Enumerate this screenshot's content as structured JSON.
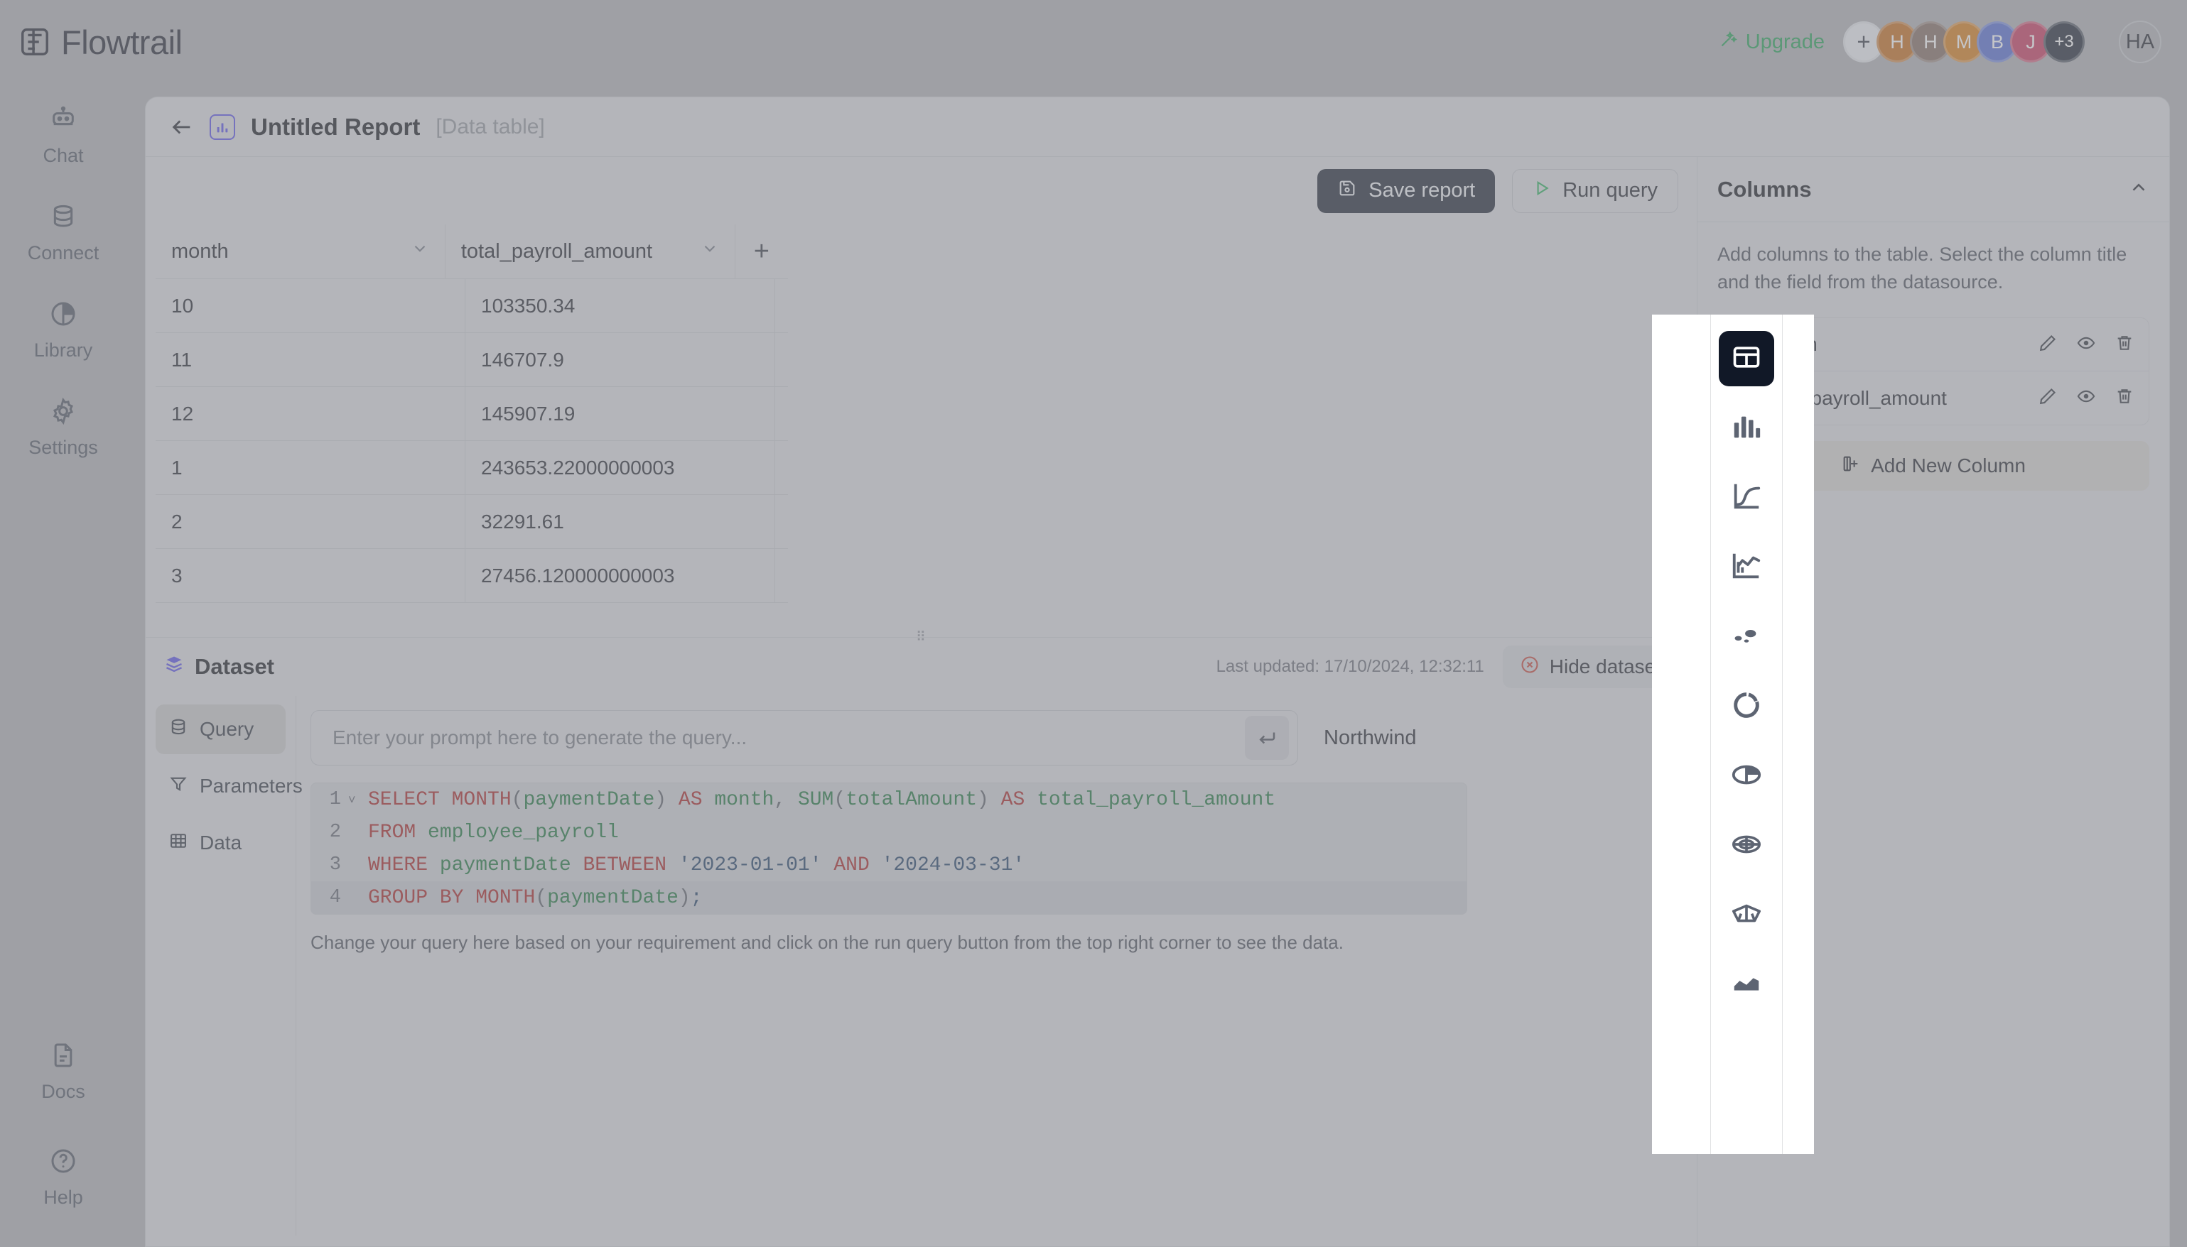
{
  "app": {
    "brand": "Flowtrail",
    "brand_logo_icon": "flowtrail-logo-icon"
  },
  "topbar": {
    "upgrade_label": "Upgrade",
    "upgrade_icon": "magic-wand-icon",
    "upgrade_color": "#179a4a",
    "add_member_label": "+",
    "avatars": [
      {
        "initial": "H",
        "color": "#c2620c"
      },
      {
        "initial": "H",
        "color": "#7b6258"
      },
      {
        "initial": "M",
        "color": "#d2730a"
      },
      {
        "initial": "B",
        "color": "#4a63cf"
      },
      {
        "initial": "J",
        "color": "#c32b52"
      }
    ],
    "overflow_label": "+3",
    "current_user_initials": "HA"
  },
  "rail": {
    "top_items": [
      {
        "label": "Chat",
        "icon": "robot-icon"
      },
      {
        "label": "Connect",
        "icon": "database-icon"
      },
      {
        "label": "Library",
        "icon": "pie-chart-icon"
      },
      {
        "label": "Settings",
        "icon": "gear-icon"
      }
    ],
    "bottom_items": [
      {
        "label": "Docs",
        "icon": "document-icon"
      },
      {
        "label": "Help",
        "icon": "question-circle-icon"
      }
    ]
  },
  "report": {
    "back_icon": "arrow-left-icon",
    "type_icon": "bar-chart-icon",
    "title": "Untitled Report",
    "subtitle": "[Data table]",
    "save_label": "Save report",
    "save_icon": "save-icon",
    "run_label": "Run query",
    "run_icon": "play-icon"
  },
  "table": {
    "columns": [
      {
        "label": "month",
        "caret_icon": "chevron-down-icon"
      },
      {
        "label": "total_payroll_amount",
        "caret_icon": "chevron-down-icon"
      }
    ],
    "add_column_label": "+",
    "rows": [
      {
        "month": "10",
        "total_payroll_amount": "103350.34"
      },
      {
        "month": "11",
        "total_payroll_amount": "146707.9"
      },
      {
        "month": "12",
        "total_payroll_amount": "145907.19"
      },
      {
        "month": "1",
        "total_payroll_amount": "243653.22000000003"
      },
      {
        "month": "2",
        "total_payroll_amount": "32291.61"
      },
      {
        "month": "3",
        "total_payroll_amount": "27456.120000000003"
      }
    ]
  },
  "dataset": {
    "title": "Dataset",
    "title_icon": "stack-icon",
    "last_updated": "Last updated: 17/10/2024, 12:32:11",
    "hide_label": "Hide dataset",
    "hide_icon": "close-circle-icon",
    "tabs": [
      {
        "label": "Query",
        "icon": "database-icon",
        "active": true
      },
      {
        "label": "Parameters",
        "icon": "filter-icon",
        "active": false
      },
      {
        "label": "Data",
        "icon": "grid-icon",
        "active": false
      }
    ],
    "prompt_placeholder": "Enter your prompt here to generate the query...",
    "prompt_value": "",
    "enter_icon": "enter-key-icon",
    "datasource_label": "Northwind",
    "datasource_icon": "datasource-icon",
    "datasource_caret": "chevron-down-icon",
    "hint": "Change your query here based on your requirement and click on the run query button from the top right corner to see the data.",
    "editor": {
      "active_line": 4,
      "lines": [
        {
          "number": "1",
          "fold": "˅",
          "tokens": [
            {
              "t": "SELECT ",
              "c": "kw"
            },
            {
              "t": "MONTH",
              "c": "fn"
            },
            {
              "t": "(",
              "c": "pun"
            },
            {
              "t": "paymentDate",
              "c": "id"
            },
            {
              "t": ")",
              "c": "pun"
            },
            {
              "t": " AS ",
              "c": "kw"
            },
            {
              "t": "month",
              "c": "id"
            },
            {
              "t": ", ",
              "c": "pun"
            },
            {
              "t": "SUM",
              "c": "id"
            },
            {
              "t": "(",
              "c": "pun"
            },
            {
              "t": "totalAmount",
              "c": "id"
            },
            {
              "t": ")",
              "c": "pun"
            },
            {
              "t": " AS ",
              "c": "kw"
            },
            {
              "t": "total_payroll_amount",
              "c": "id"
            }
          ]
        },
        {
          "number": "2",
          "fold": "",
          "tokens": [
            {
              "t": "FROM ",
              "c": "kw"
            },
            {
              "t": "employee_payroll",
              "c": "id"
            }
          ]
        },
        {
          "number": "3",
          "fold": "",
          "tokens": [
            {
              "t": "WHERE ",
              "c": "kw"
            },
            {
              "t": "paymentDate",
              "c": "id"
            },
            {
              "t": " BETWEEN ",
              "c": "kw"
            },
            {
              "t": "'2023-01-01'",
              "c": "str"
            },
            {
              "t": " AND ",
              "c": "kw"
            },
            {
              "t": "'2024-03-31'",
              "c": "str"
            }
          ]
        },
        {
          "number": "4",
          "fold": "",
          "tokens": [
            {
              "t": "GROUP BY ",
              "c": "kw"
            },
            {
              "t": "MONTH",
              "c": "fn"
            },
            {
              "t": "(",
              "c": "pun"
            },
            {
              "t": "paymentDate",
              "c": "id"
            },
            {
              "t": ")",
              "c": "pun"
            },
            {
              "t": ";",
              "c": "str"
            }
          ]
        }
      ]
    }
  },
  "columns_panel": {
    "title": "Columns",
    "collapse_icon": "chevron-up-icon",
    "description": "Add columns to the table. Select the column title and the field from the datasource.",
    "items": [
      {
        "name": "month",
        "drag_icon": "drag-handle-icon",
        "edit_icon": "pencil-icon",
        "visibility_icon": "eye-icon",
        "delete_icon": "trash-icon"
      },
      {
        "name": "total_payroll_amount",
        "drag_icon": "drag-handle-icon",
        "edit_icon": "pencil-icon",
        "visibility_icon": "eye-icon",
        "delete_icon": "trash-icon"
      }
    ],
    "add_label": "Add New Column",
    "add_icon": "add-column-icon"
  },
  "chart_types": [
    {
      "name": "table",
      "icon": "table-icon",
      "active": true
    },
    {
      "name": "bar",
      "icon": "bar-chart-icon",
      "active": false
    },
    {
      "name": "line",
      "icon": "line-chart-icon",
      "active": false
    },
    {
      "name": "combo",
      "icon": "combo-chart-icon",
      "active": false
    },
    {
      "name": "scatter",
      "icon": "scatter-plot-icon",
      "active": false
    },
    {
      "name": "donut",
      "icon": "donut-chart-icon",
      "active": false
    },
    {
      "name": "pie",
      "icon": "pie-chart-icon",
      "active": false
    },
    {
      "name": "radar",
      "icon": "radar-chart-icon",
      "active": false
    },
    {
      "name": "funnel",
      "icon": "funnel-chart-icon",
      "active": false
    },
    {
      "name": "area",
      "icon": "area-chart-icon",
      "active": false
    }
  ]
}
